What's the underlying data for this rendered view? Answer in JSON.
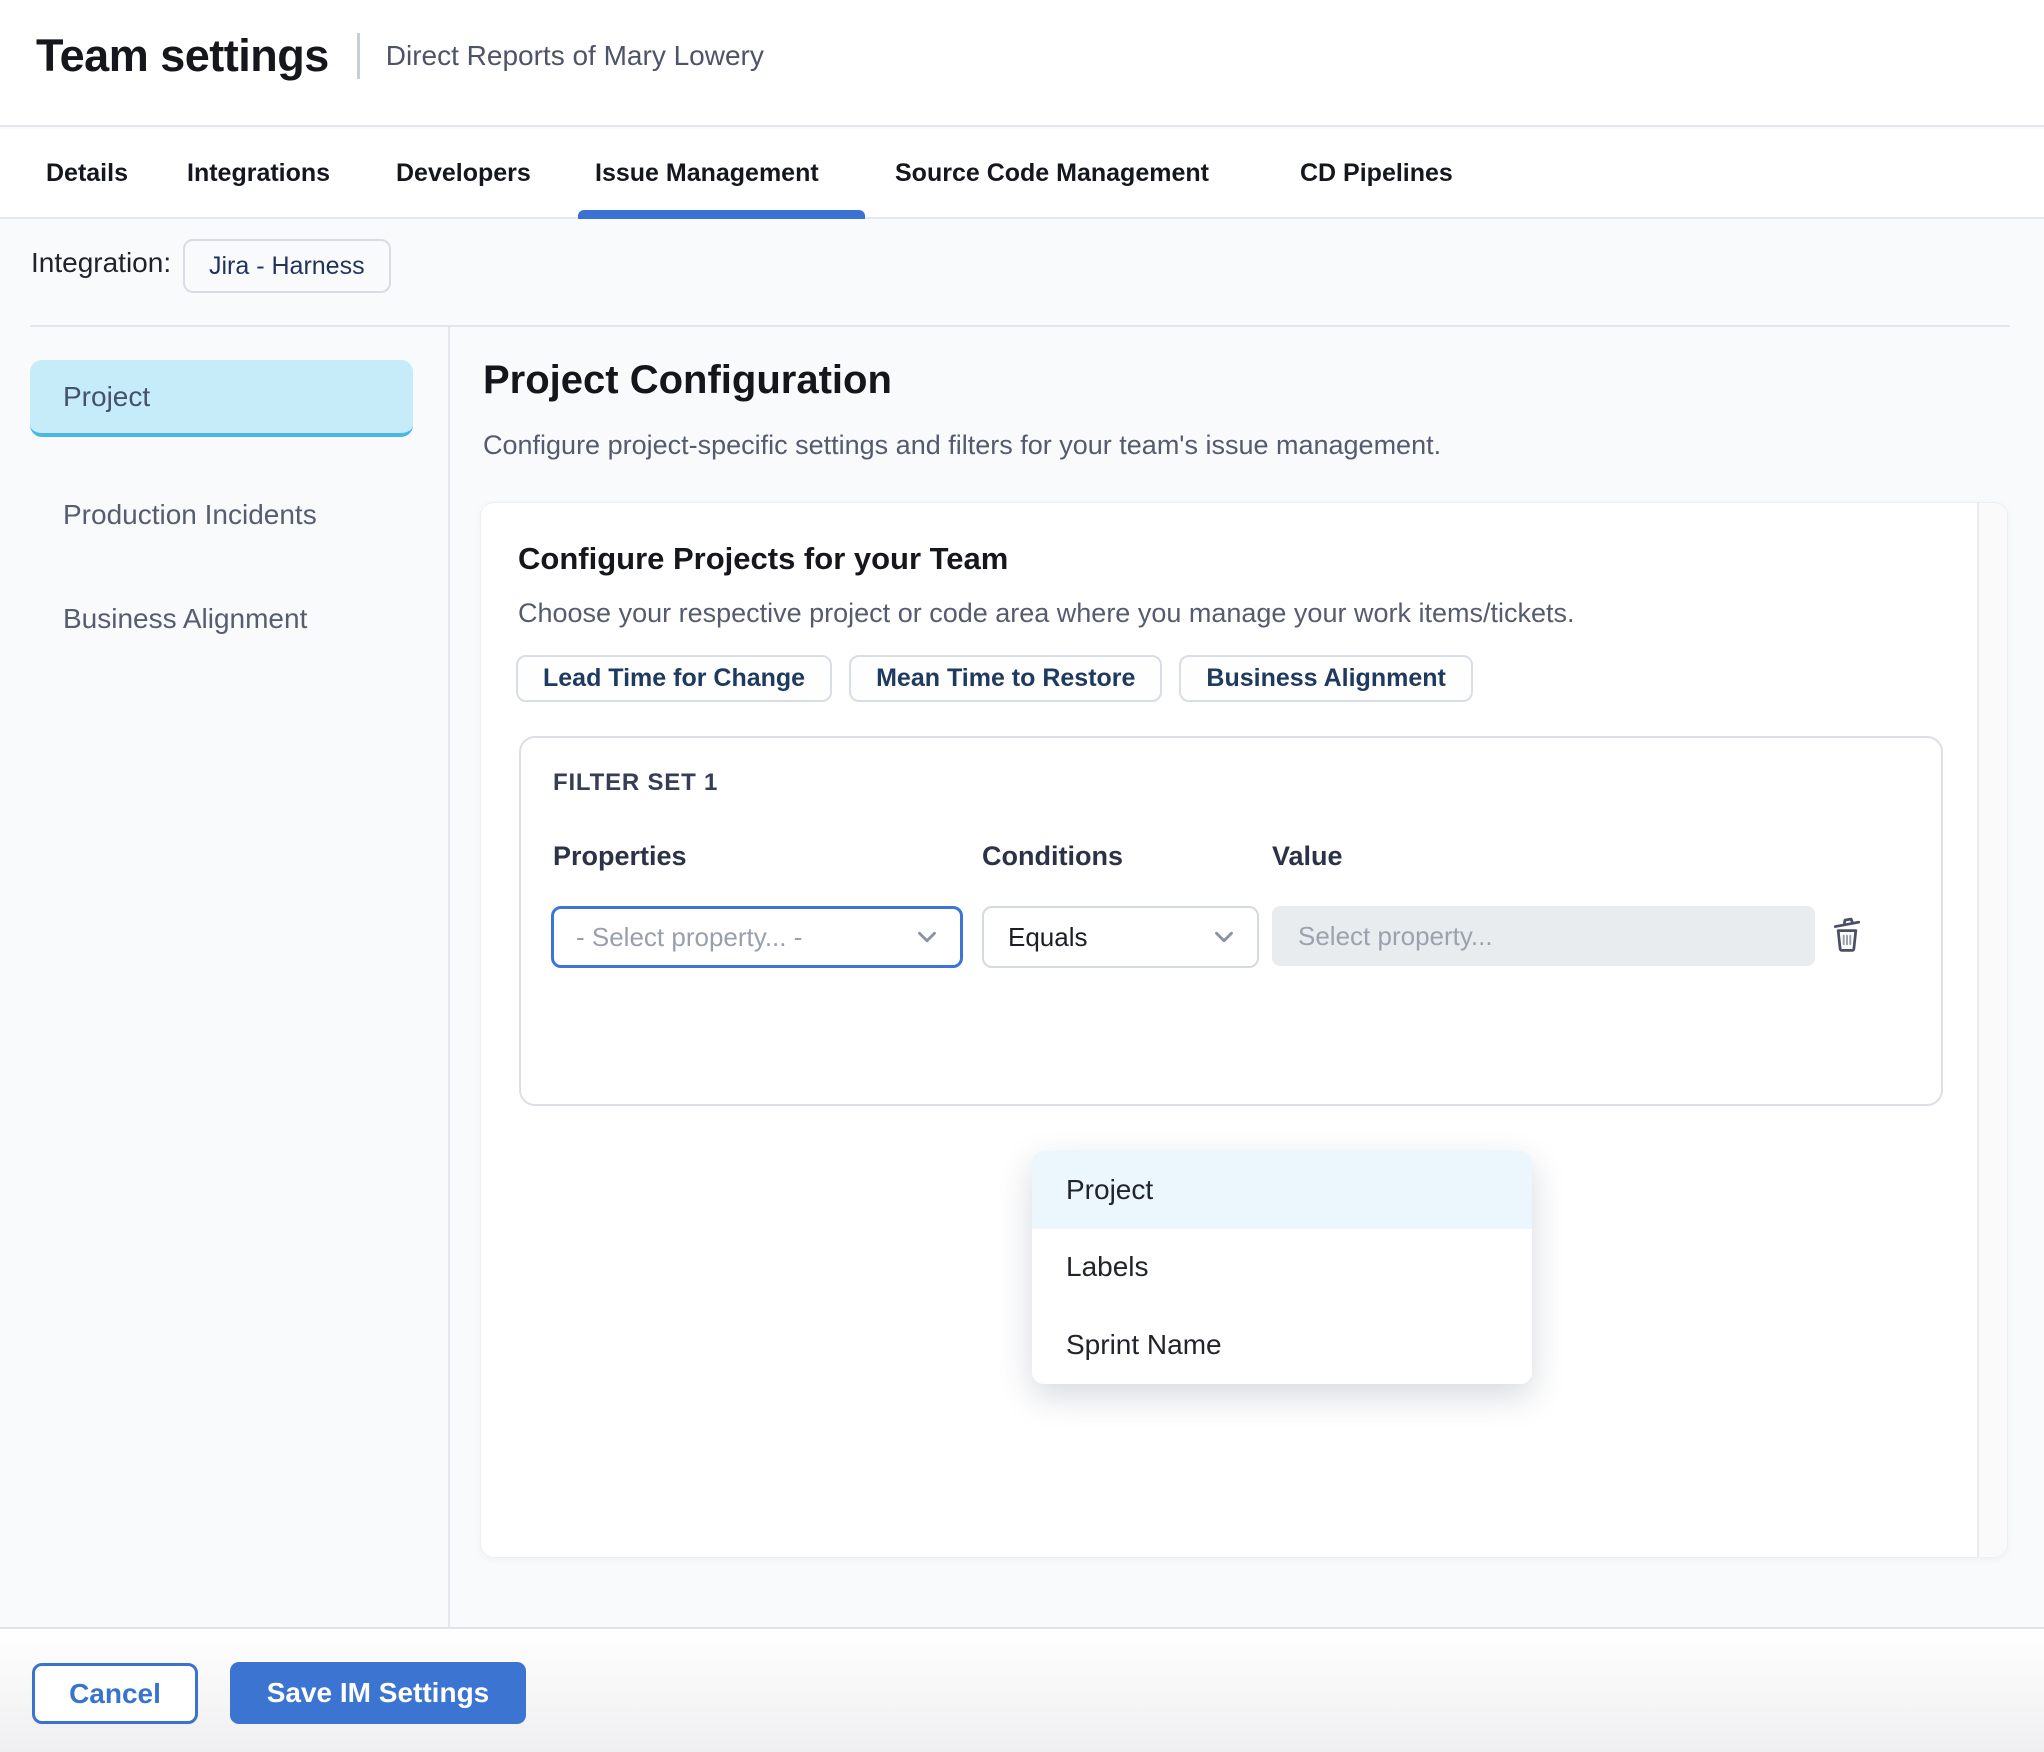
{
  "header": {
    "title": "Team settings",
    "subtitle": "Direct Reports of Mary Lowery"
  },
  "tabs": [
    {
      "label": "Details",
      "active": false
    },
    {
      "label": "Integrations",
      "active": false
    },
    {
      "label": "Developers",
      "active": false
    },
    {
      "label": "Issue Management",
      "active": true
    },
    {
      "label": "Source Code Management",
      "active": false
    },
    {
      "label": "CD Pipelines",
      "active": false
    }
  ],
  "integration": {
    "label": "Integration:",
    "chip": "Jira - Harness"
  },
  "sidebar": {
    "items": [
      {
        "label": "Project",
        "selected": true
      },
      {
        "label": "Production Incidents",
        "selected": false
      },
      {
        "label": "Business Alignment",
        "selected": false
      }
    ]
  },
  "main": {
    "title": "Project Configuration",
    "subtitle": "Configure project-specific settings and filters for your team's issue management.",
    "card": {
      "title": "Configure Projects for your Team",
      "subtitle": "Choose your respective project or code area where you manage your work items/tickets.",
      "chips": [
        "Lead Time for Change",
        "Mean Time to Restore",
        "Business Alignment"
      ],
      "filter_set": {
        "title": "FILTER SET 1",
        "columns": {
          "properties": "Properties",
          "conditions": "Conditions",
          "value": "Value"
        },
        "property_placeholder": "- Select property... -",
        "condition_value": "Equals",
        "value_placeholder": "Select property...",
        "dropdown": {
          "options": [
            "Project",
            "Labels",
            "Sprint Name"
          ],
          "highlighted": "Project"
        }
      }
    }
  },
  "footer": {
    "cancel_label": "Cancel",
    "save_label": "Save IM Settings"
  },
  "icons": [
    "chevron-down-icon",
    "trash-icon"
  ],
  "colors": {
    "accent_blue": "#3b74d1",
    "tab_underline": "#3a72d4",
    "focus_border": "#3b74da",
    "sidebar_selected_bg": "#c6ecfa",
    "sidebar_selected_edge": "#49b8e5",
    "dropdown_highlight": "#ebf6fd",
    "page_bg": "#f8fafc",
    "chip_text": "#21335d",
    "disabled_input_bg": "#e8ecef"
  }
}
